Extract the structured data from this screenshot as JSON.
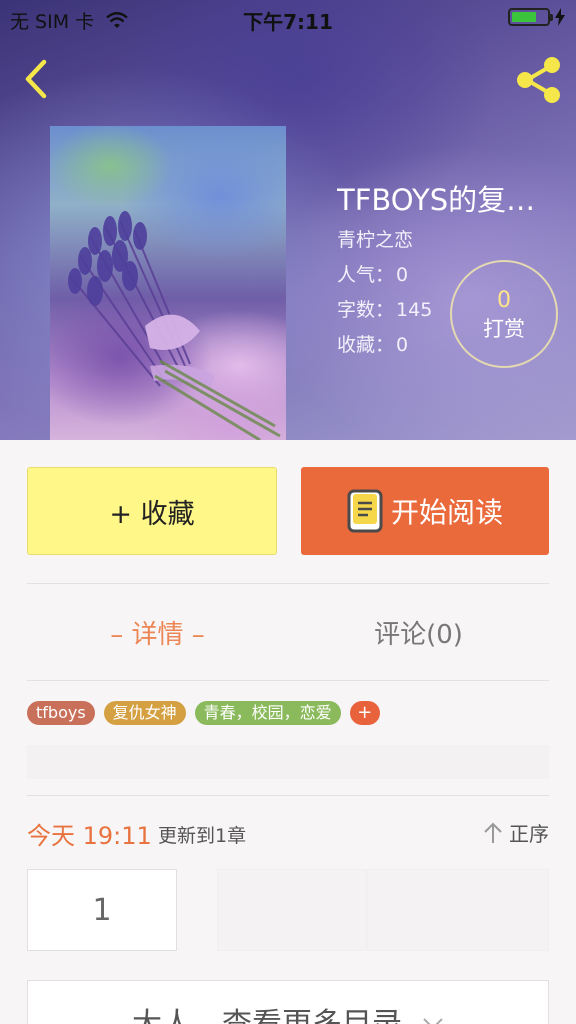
{
  "status_bar": {
    "carrier": "无 SIM 卡",
    "time": "下午7:11",
    "battery_level": 0.72,
    "battery_color": "#3cc33c"
  },
  "header": {
    "back_icon": "chevron-left-icon",
    "share_icon": "share-icon",
    "accent_color": "#f5e64a"
  },
  "book": {
    "title": "TFBOYS的复…",
    "author": "青柠之恋",
    "stats": [
      {
        "label": "人气：",
        "value": "0"
      },
      {
        "label": "字数：",
        "value": "145"
      },
      {
        "label": "收藏：",
        "value": "0"
      }
    ],
    "reward": {
      "count": "0",
      "label": "打赏"
    }
  },
  "actions": {
    "collect_label": "+ 收藏",
    "read_label": "开始阅读",
    "collect_color": "#fff888",
    "read_color": "#ea6a3c"
  },
  "tabs": [
    {
      "label": "– 详情 –",
      "active": true
    },
    {
      "label": "评论(0)",
      "active": false
    }
  ],
  "tags": [
    {
      "label": "tfboys",
      "color": "#c9705a"
    },
    {
      "label": "复仇女神",
      "color": "#d4a042"
    },
    {
      "label": "青春，校园，恋爱",
      "color": "#8bba5c"
    }
  ],
  "tag_add_label": "+",
  "update": {
    "time": "今天 19:11",
    "text": "更新到1章",
    "sort_label": "正序"
  },
  "chapters": [
    "1",
    "",
    "",
    ""
  ],
  "more_catalog_label": "大人，查看更多目录"
}
